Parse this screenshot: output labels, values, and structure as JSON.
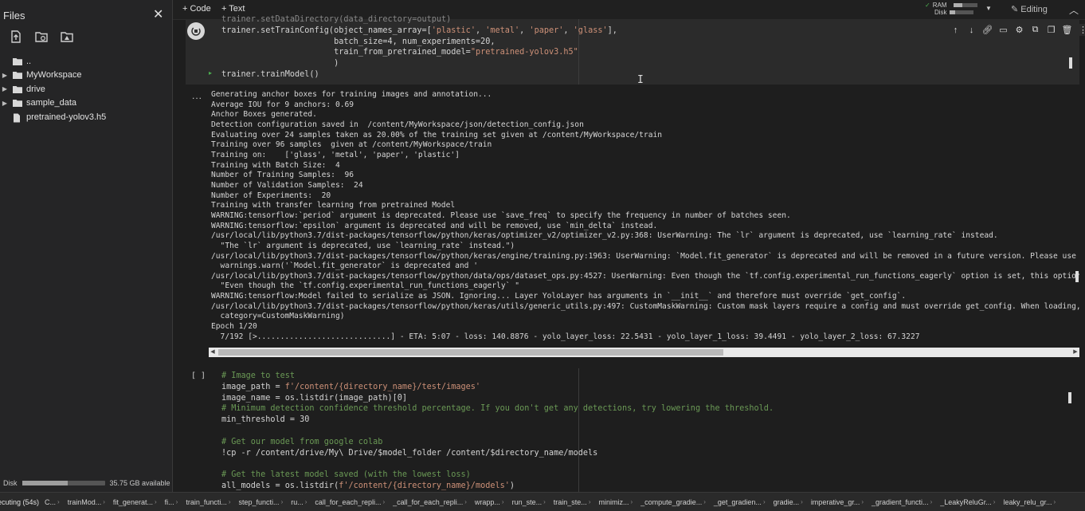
{
  "sidebar": {
    "title": "Files",
    "close": "✕",
    "tree": [
      {
        "label": "..",
        "type": "folder-up",
        "caret": ""
      },
      {
        "label": "MyWorkspace",
        "type": "folder",
        "caret": "▶"
      },
      {
        "label": "drive",
        "type": "folder",
        "caret": "▶"
      },
      {
        "label": "sample_data",
        "type": "folder",
        "caret": "▶"
      },
      {
        "label": "pretrained-yolov3.h5",
        "type": "file",
        "caret": ""
      }
    ],
    "disk_label": "Disk",
    "disk_used_fraction": 0.55,
    "disk_available": "35.75 GB available"
  },
  "toolbar": {
    "add_code": "+ Code",
    "add_text": "+ Text",
    "ram_label": "RAM",
    "disk_label": "Disk",
    "ram_fraction": 0.35,
    "disk_fraction": 0.25,
    "editing": "Editing"
  },
  "cell1": {
    "lines": [
      "trainer.setDataDirectory(data_directory=output)",
      "trainer.setTrainConfig(object_names_array=['plastic', 'metal', 'paper', 'glass'],",
      "                       batch_size=4, num_experiments=20,",
      "                       train_from_pretrained_model=\"pretrained-yolov3.h5\"",
      "                       )",
      "trainer.trainModel()"
    ]
  },
  "output": {
    "dots": "...",
    "lines": [
      "Generating anchor boxes for training images and annotation...",
      "Average IOU for 9 anchors: 0.69",
      "Anchor Boxes generated.",
      "Detection configuration saved in  /content/MyWorkspace/json/detection_config.json",
      "Evaluating over 24 samples taken as 20.00% of the training set given at /content/MyWorkspace/train",
      "Training over 96 samples  given at /content/MyWorkspace/train",
      "Training on:    ['glass', 'metal', 'paper', 'plastic']",
      "Training with Batch Size:  4",
      "Number of Training Samples:  96",
      "Number of Validation Samples:  24",
      "Number of Experiments:  20",
      "Training with transfer learning from pretrained Model",
      "WARNING:tensorflow:`period` argument is deprecated. Please use `save_freq` to specify the frequency in number of batches seen.",
      "WARNING:tensorflow:`epsilon` argument is deprecated and will be removed, use `min_delta` instead.",
      "/usr/local/lib/python3.7/dist-packages/tensorflow/python/keras/optimizer_v2/optimizer_v2.py:368: UserWarning: The `lr` argument is deprecated, use `learning_rate` instead.",
      "  \"The `lr` argument is deprecated, use `learning_rate` instead.\")",
      "/usr/local/lib/python3.7/dist-packages/tensorflow/python/keras/engine/training.py:1963: UserWarning: `Model.fit_generator` is deprecated and will be removed in a future version. Please use `Model",
      "  warnings.warn('`Model.fit_generator` is deprecated and '",
      "/usr/local/lib/python3.7/dist-packages/tensorflow/python/data/ops/dataset_ops.py:4527: UserWarning: Even though the `tf.config.experimental_run_functions_eagerly` option is set, this option does",
      "  \"Even though the `tf.config.experimental_run_functions_eagerly` \"",
      "WARNING:tensorflow:Model failed to serialize as JSON. Ignoring... Layer YoloLayer has arguments in `__init__` and therefore must override `get_config`.",
      "/usr/local/lib/python3.7/dist-packages/tensorflow/python/keras/utils/generic_utils.py:497: CustomMaskWarning: Custom mask layers require a config and must override get_config. When loading, the c",
      "  category=CustomMaskWarning)",
      "Epoch 1/20",
      "  7/192 [>.............................] - ETA: 5:07 - loss: 140.8876 - yolo_layer_loss: 22.5431 - yolo_layer_1_loss: 39.4491 - yolo_layer_2_loss: 67.3227"
    ]
  },
  "cell2": {
    "prompt": "[ ]",
    "lines": [
      {
        "t": "# Image to test",
        "k": "cmt"
      },
      {
        "t": "image_path = f'/content/{directory_name}/test/images'",
        "k": "code"
      },
      {
        "t": "image_name = os.listdir(image_path)[0]",
        "k": "code"
      },
      {
        "t": "# Minimum detection confidence threshold percentage. If you don't get any detections, try lowering the threshold.",
        "k": "cmt"
      },
      {
        "t": "min_threshold = 30",
        "k": "code"
      },
      {
        "t": "",
        "k": "code"
      },
      {
        "t": "# Get our model from google colab",
        "k": "cmt"
      },
      {
        "t": "!cp -r /content/drive/My\\ Drive/$model_folder /content/$directory_name/models",
        "k": "code"
      },
      {
        "t": "",
        "k": "code"
      },
      {
        "t": "# Get the latest model saved (with the lowest loss)",
        "k": "cmt"
      },
      {
        "t": "all_models = os.listdir(f'/content/{directory_name}/models')",
        "k": "code"
      }
    ]
  },
  "statusbar": {
    "executing": "ecuting (54s)",
    "frames": [
      "C...",
      "trainMod...",
      "fit_generat...",
      "fi...",
      "train_functi...",
      "step_functi...",
      "ru...",
      "call_for_each_repli...",
      "_call_for_each_repli...",
      "wrapp...",
      "run_ste...",
      "train_ste...",
      "minimiz...",
      "_compute_gradie...",
      "_get_gradien...",
      "gradie...",
      "imperative_gr...",
      "_gradient_functi...",
      "_LeakyReluGr...",
      "leaky_relu_gr..."
    ]
  }
}
